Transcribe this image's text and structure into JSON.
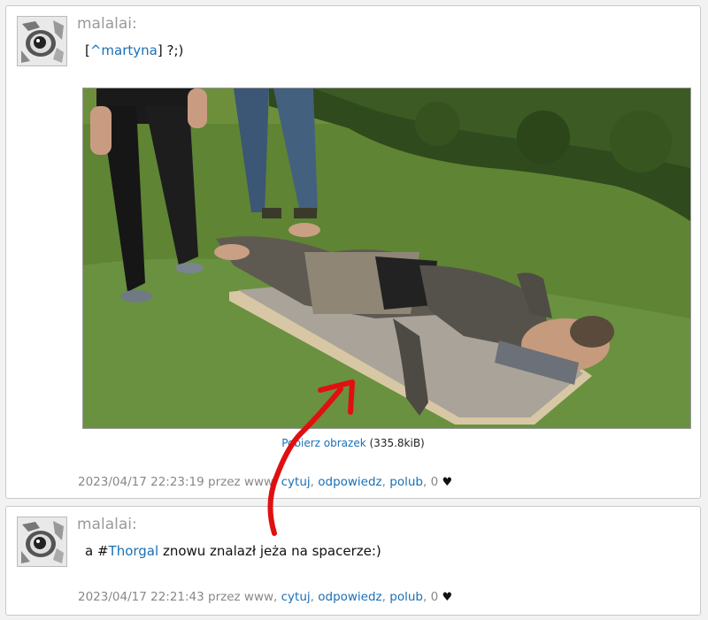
{
  "posts": [
    {
      "author": "malalai:",
      "mention_open": "[",
      "mention": "^martyna",
      "mention_close": "]",
      "text_after": " ?;)",
      "image_link": "Pobierz obrazek",
      "image_size": "(335.8kiB)",
      "timestamp": "2023/04/17 22:23:19",
      "via": " przez www, ",
      "actions": {
        "quote": "cytuj",
        "reply": "odpowiedz",
        "like": "polub"
      },
      "likes": "0"
    },
    {
      "author": "malalai:",
      "text_before": "a #",
      "tag": "Thorgal",
      "text_after": " znowu znalazł jeża na spacerze:)",
      "timestamp": "2023/04/17 22:21:43",
      "via": " przez www, ",
      "actions": {
        "quote": "cytuj",
        "reply": "odpowiedz",
        "like": "polub"
      },
      "likes": "0"
    }
  ],
  "icons": {
    "heart": "♥",
    "avatar": "eye-avatar-icon"
  },
  "colors": {
    "link": "#1a6fb5",
    "annotation_arrow": "#e01010",
    "author": "#9a9a9a"
  }
}
